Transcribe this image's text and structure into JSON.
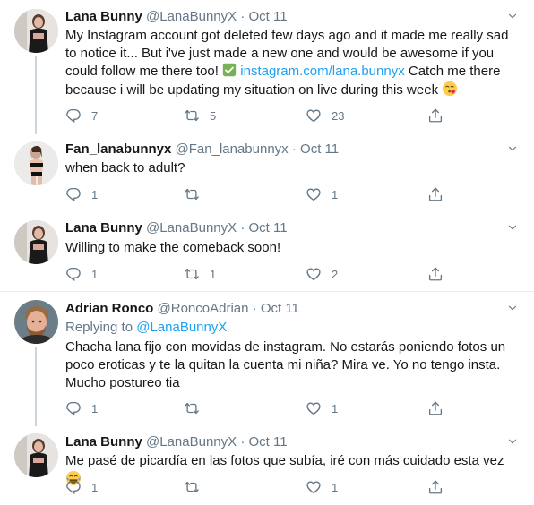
{
  "tweets": [
    {
      "name": "Lana Bunny",
      "handle": "@LanaBunnyX",
      "sep": "·",
      "date": "Oct 11",
      "avatar": "woman-black-outfit-photo",
      "body_1": "My Instagram account got deleted few days ago and it made me really sad to notice it... But i've just made a new one and would be awesome if you could follow me there too! ",
      "link": "instagram.com/lana.bunnyx",
      "body_2": " Catch me there because i will be updating my situation on live during this week ",
      "emoji": "kissing-face-emoji",
      "replies": "7",
      "retweets": "5",
      "likes": "23"
    },
    {
      "name": "Fan_lanabunnyx",
      "handle": "@Fan_lanabunnyx",
      "sep": "·",
      "date": "Oct 11",
      "avatar": "woman-lingerie-photo",
      "body": "when back to adult?",
      "replies": "1",
      "retweets": "",
      "likes": "1"
    },
    {
      "name": "Lana Bunny",
      "handle": "@LanaBunnyX",
      "sep": "·",
      "date": "Oct 11",
      "avatar": "woman-black-outfit-photo",
      "body": "Willing to make the comeback soon!",
      "replies": "1",
      "retweets": "1",
      "likes": "2"
    },
    {
      "name": "Adrian Ronco",
      "handle": "@RoncoAdrian",
      "sep": "·",
      "date": "Oct 11",
      "avatar": "man-portrait-photo",
      "replying_label": "Replying to ",
      "replying_handle": "@LanaBunnyX",
      "body": "Chacha lana fijo con movidas de instagram. No estarás poniendo fotos un poco eroticas y te la quitan la cuenta mi niña? Mira ve. Yo no tengo insta. Mucho postureo tia",
      "replies": "1",
      "retweets": "",
      "likes": "1"
    },
    {
      "name": "Lana Bunny",
      "handle": "@LanaBunnyX",
      "sep": "·",
      "date": "Oct 11",
      "avatar": "woman-black-outfit-photo",
      "body": "Me pasé de picardía en las fotos que subía, iré con más cuidado esta vez ",
      "emoji": "tears-of-joy-emoji",
      "replies": "1",
      "retweets": "",
      "likes": "1"
    }
  ],
  "icons": {
    "reply": "reply-icon",
    "retweet": "retweet-icon",
    "like": "heart-icon",
    "share": "share-icon",
    "menu": "chevron-down-icon",
    "verified_link": "green-check-emoji"
  },
  "colors": {
    "link": "#1da1f2",
    "secondary_text": "#657786",
    "divider": "#e6ecf0",
    "thread_line": "#ccd6dd"
  }
}
